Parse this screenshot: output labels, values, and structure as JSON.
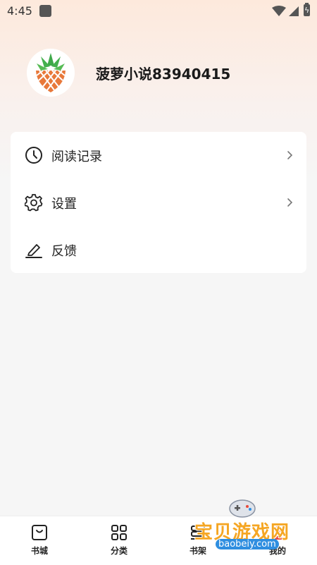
{
  "status_bar": {
    "time": "4:45"
  },
  "profile": {
    "username": "菠萝小说83940415"
  },
  "menu": [
    {
      "label": "阅读记录",
      "icon": "clock-icon",
      "has_chevron": true
    },
    {
      "label": "设置",
      "icon": "gear-icon",
      "has_chevron": true
    },
    {
      "label": "反馈",
      "icon": "edit-icon",
      "has_chevron": false
    }
  ],
  "bottom_nav": [
    {
      "label": "书城",
      "icon": "bag-icon"
    },
    {
      "label": "分类",
      "icon": "grid-icon"
    },
    {
      "label": "书架",
      "icon": "books-icon"
    },
    {
      "label": "我的",
      "icon": "profile-icon"
    }
  ],
  "watermark": {
    "title": "宝贝游戏网",
    "url": "baobeiy.com"
  },
  "colors": {
    "accent": "#f5a623",
    "brand_orange": "#e8783a",
    "leaf_green": "#3ea84a"
  }
}
